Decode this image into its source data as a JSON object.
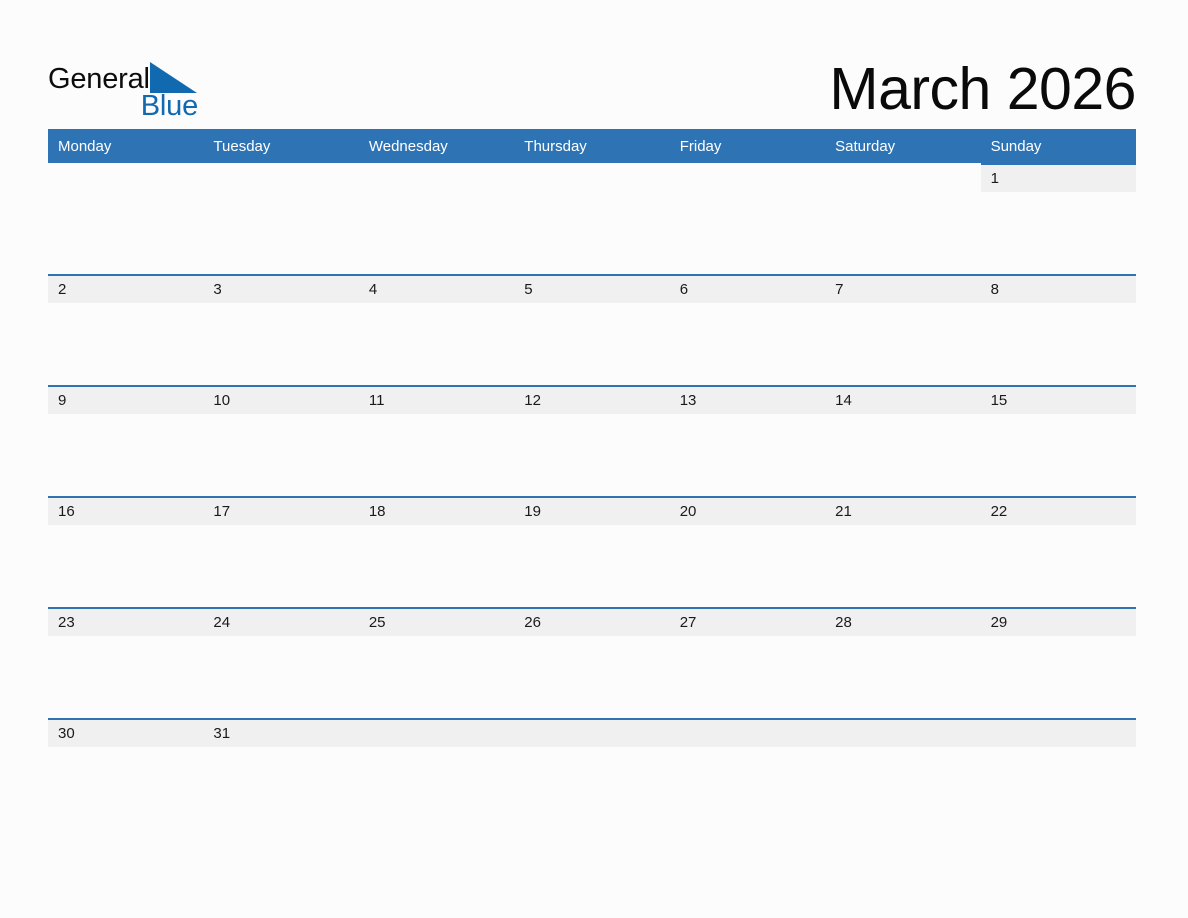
{
  "brand": {
    "name_primary": "General",
    "name_secondary": "Blue",
    "triangle_icon": "triangle-icon",
    "color_primary": "#0d0d0d",
    "color_secondary": "#1169b0"
  },
  "header": {
    "title": "March 2026",
    "month": "March",
    "year": "2026"
  },
  "colors": {
    "header_blue": "#2e74b5",
    "row_rule_blue": "#2e74b5",
    "date_band_gray": "#f0f0f0",
    "page_background": "#fcfcfc",
    "text_dark": "#1a1a1a",
    "text_on_blue": "#ffffff"
  },
  "calendar": {
    "first_day_of_week": "Monday",
    "weekdays": [
      "Monday",
      "Tuesday",
      "Wednesday",
      "Thursday",
      "Friday",
      "Saturday",
      "Sunday"
    ],
    "weeks": [
      [
        "",
        "",
        "",
        "",
        "",
        "",
        "1"
      ],
      [
        "2",
        "3",
        "4",
        "5",
        "6",
        "7",
        "8"
      ],
      [
        "9",
        "10",
        "11",
        "12",
        "13",
        "14",
        "15"
      ],
      [
        "16",
        "17",
        "18",
        "19",
        "20",
        "21",
        "22"
      ],
      [
        "23",
        "24",
        "25",
        "26",
        "27",
        "28",
        "29"
      ],
      [
        "30",
        "31",
        "",
        "",
        "",
        "",
        ""
      ]
    ],
    "last_week_band_full_width": true
  }
}
